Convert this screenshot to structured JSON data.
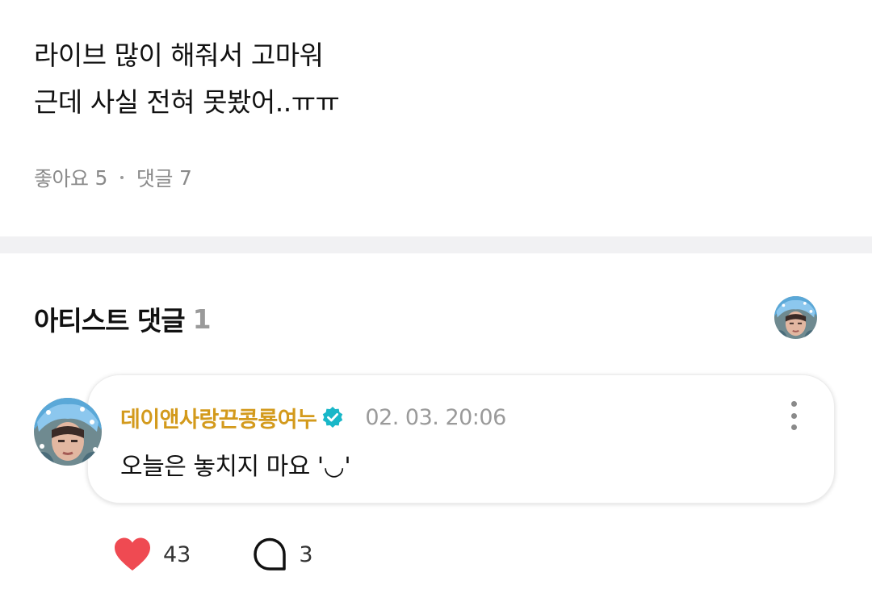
{
  "post": {
    "lines": [
      "라이브 많이 해줘서 고마워",
      "근데 사실 전혀 못봤어..ㅠㅠ"
    ],
    "likes_label": "좋아요",
    "likes_count": "5",
    "comments_label": "댓글",
    "comments_count": "7"
  },
  "artist_comments": {
    "title": "아티스트 댓글",
    "count": "1"
  },
  "comment": {
    "author": "데이앤사랑끈콩룡여누",
    "verified_icon": "verified-check-icon",
    "time": "02. 03. 20:06",
    "text": "오늘은 놓치지 마요 '◡'",
    "likes": "43",
    "replies": "3"
  },
  "colors": {
    "author": "#d39a1c",
    "verified": "#19b7c8",
    "heart": "#ef4a52",
    "divider": "#f1f1f3",
    "muted": "#8a8a8a"
  }
}
